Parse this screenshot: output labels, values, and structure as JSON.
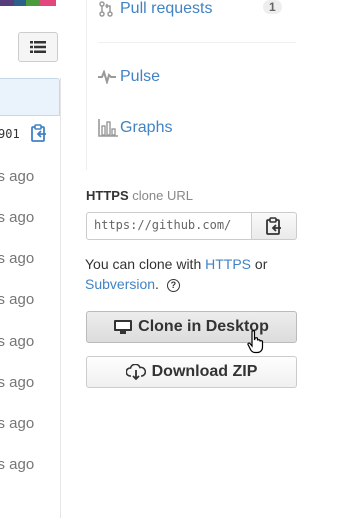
{
  "colors": {
    "link": "#4183c4",
    "lang_bar": [
      "#563d7c",
      "#2c5f8a",
      "#4b9b3c",
      "#e5457d"
    ]
  },
  "left": {
    "sha": "901",
    "times": [
      "ys ago",
      "ys ago",
      "ys ago",
      "ys ago",
      "ys ago",
      "ys ago",
      "ys ago",
      "ys ago"
    ]
  },
  "nav": {
    "pull_requests": "Pull requests",
    "pull_requests_count": "1",
    "pulse": "Pulse",
    "graphs": "Graphs"
  },
  "clone": {
    "protocol": "HTTPS",
    "label": "clone URL",
    "url": "https://github.com/",
    "help_prefix": "You can clone with",
    "https_link": "HTTPS",
    "or": "or",
    "subversion_link": "Subversion",
    "period": "."
  },
  "buttons": {
    "desktop": "Clone in Desktop",
    "zip": "Download ZIP"
  },
  "icons": {
    "list": "list-icon",
    "copy": "clipboard-icon",
    "pull": "pull-request-icon",
    "pulse": "pulse-icon",
    "graphs": "graph-icon",
    "desktop": "monitor-icon",
    "zip": "cloud-download-icon",
    "cursor": "hand-pointer-icon",
    "help": "question-icon"
  }
}
